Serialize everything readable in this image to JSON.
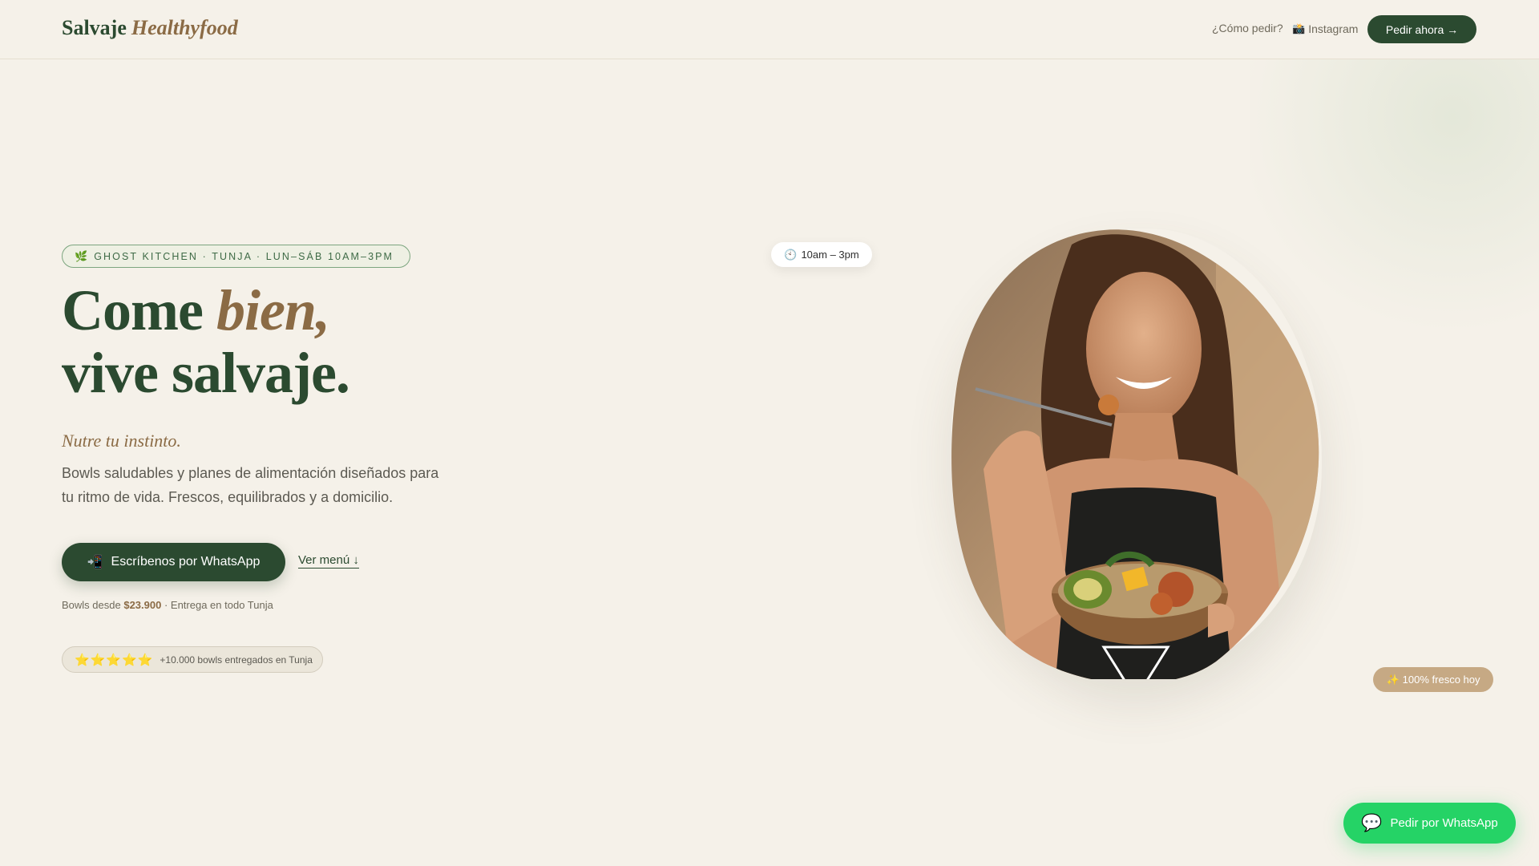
{
  "header": {
    "logo_main": "Salvaje",
    "logo_accent": "Healthyfood",
    "nav_how": "¿Cómo pedir?",
    "nav_instagram_icon": "camera-icon",
    "nav_instagram": "Instagram",
    "cta": "Pedir ahora →"
  },
  "hero": {
    "tag_icon": "leaf-icon",
    "tag": "GHOST KITCHEN · TUNJA · LUN–SÁB 10AM–3PM",
    "headline_1a": "Come",
    "headline_1b": "bien,",
    "headline_2": "vive salvaje.",
    "subtitle": "Nutre tu instinto.",
    "description": "Bowls saludables y planes de alimentación diseñados para tu ritmo de vida. Frescos, equilibrados y a domicilio.",
    "primary_cta_icon": "phone-arrow-icon",
    "primary_cta": "Escríbenos por WhatsApp",
    "secondary_cta": "Ver menú ↓",
    "price_prefix": "Bowls desde",
    "price": "$23.900",
    "price_suffix": "· Entrega en todo Tunja",
    "rating_stars": "⭐⭐⭐⭐⭐",
    "rating_text": "+10.000 bowls entregados en Tunja"
  },
  "badges": {
    "hours_icon": "clock-icon",
    "hours": "10am – 3pm",
    "fresh_icon": "sparkles-icon",
    "fresh": "100% fresco hoy"
  },
  "floating_whatsapp": {
    "icon": "chat-bubble-icon",
    "label": "Pedir por WhatsApp"
  },
  "colors": {
    "background": "#f5f1e9",
    "primary_green": "#2b4a30",
    "accent_brown": "#8b6b45",
    "whatsapp_green": "#25d366",
    "badge_tan": "#c6a984"
  }
}
